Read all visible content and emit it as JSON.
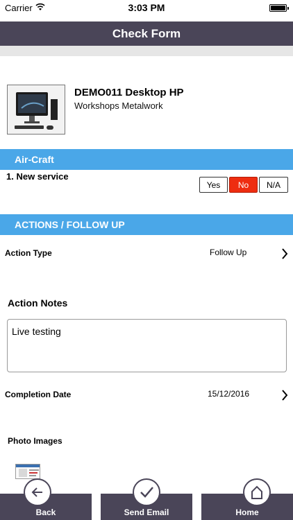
{
  "status_bar": {
    "carrier": "Carrier",
    "time": "3:03 PM"
  },
  "nav": {
    "title": "Check Form"
  },
  "asset": {
    "name": "DEMO011 Desktop HP",
    "location": "Workshops Metalwork"
  },
  "sections": {
    "aircraft": {
      "title": "Air-Craft"
    },
    "actions": {
      "title": "ACTIONS / FOLLOW UP"
    }
  },
  "question": {
    "text": "1. New service",
    "answers": [
      "Yes",
      "No",
      "N/A"
    ],
    "selected": "No"
  },
  "action_type": {
    "label": "Action Type",
    "value": "Follow Up"
  },
  "action_notes": {
    "label": "Action Notes",
    "value": "Live testing"
  },
  "completion_date": {
    "label": "Completion Date",
    "value": "15/12/2016"
  },
  "photos": {
    "label": "Photo Images"
  },
  "tabs": {
    "back": "Back",
    "email": "Send Email",
    "home": "Home"
  },
  "colors": {
    "nav_bg": "#4a4558",
    "section_bg": "#4aa7e8",
    "selected_answer": "#ee2d10"
  }
}
